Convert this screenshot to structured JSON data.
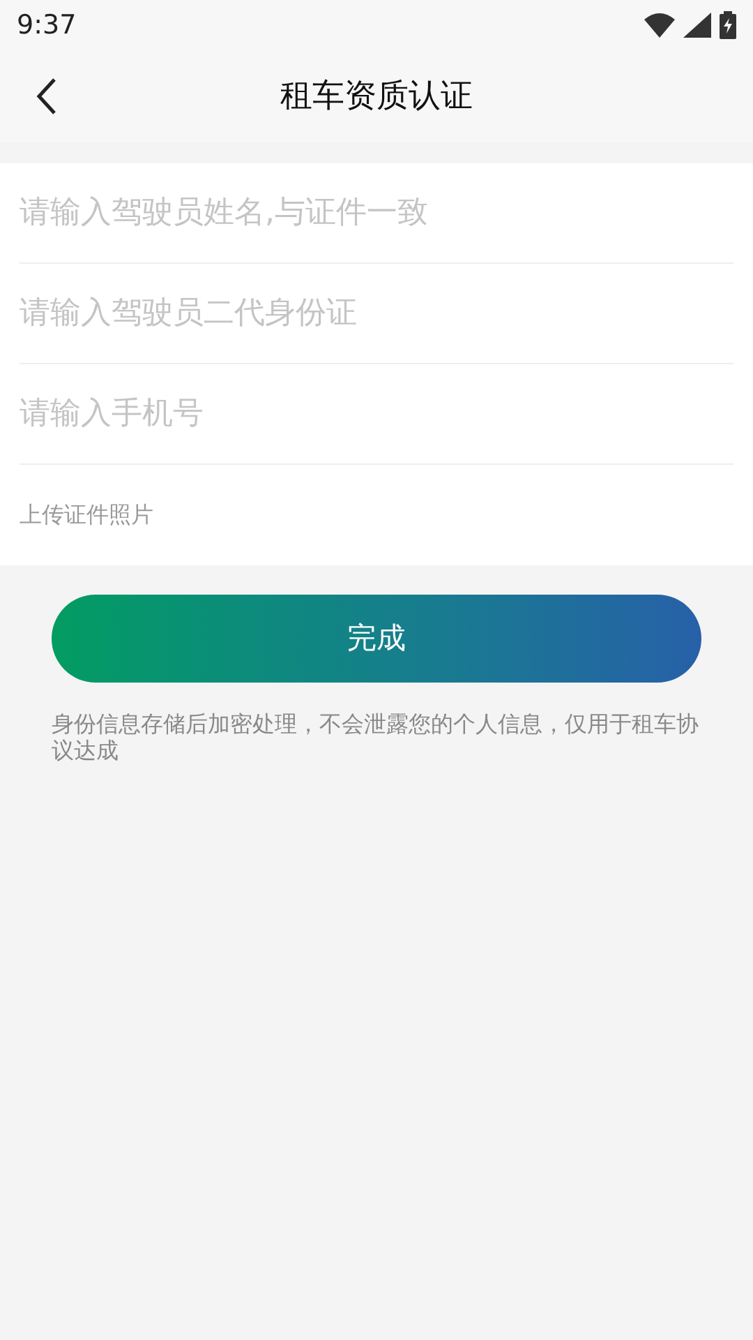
{
  "status_bar": {
    "time": "9:37"
  },
  "header": {
    "title": "租车资质认证"
  },
  "fields": [
    {
      "placeholder": "请输入驾驶员姓名,与证件一致"
    },
    {
      "placeholder": "请输入驾驶员二代身份证"
    },
    {
      "placeholder": "请输入手机号"
    }
  ],
  "upload_label": "上传证件照片",
  "submit_button": "完成",
  "note": "身份信息存储后加密处理，不会泄露您的个人信息，仅用于租车协议达成"
}
